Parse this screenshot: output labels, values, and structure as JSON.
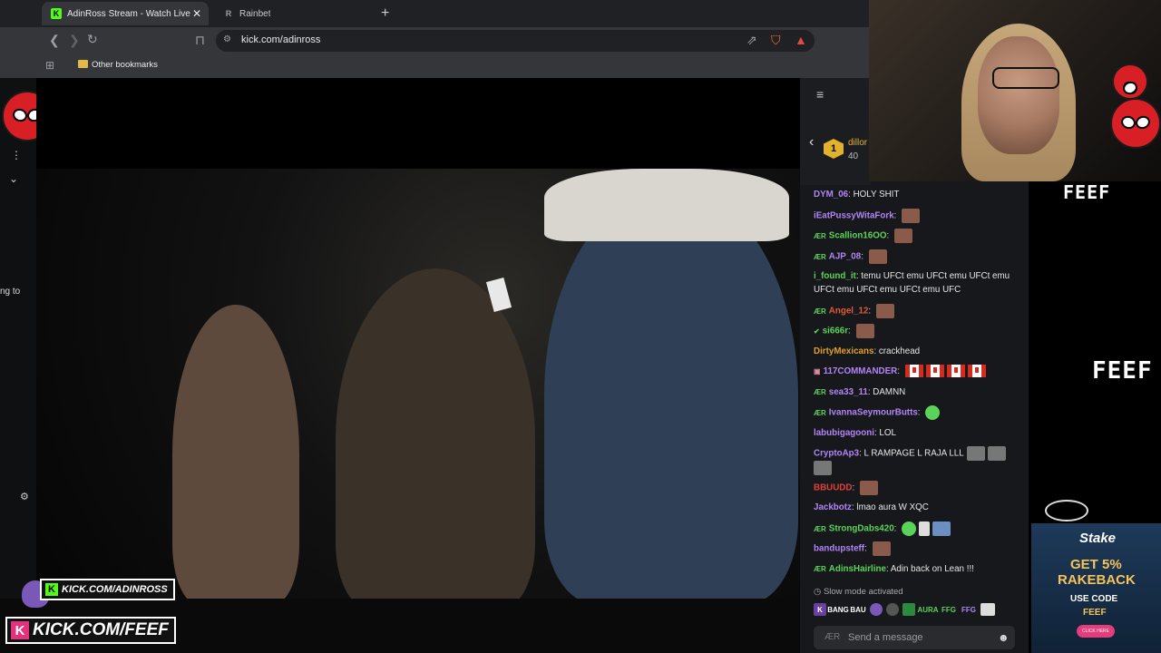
{
  "browser": {
    "tabs": [
      {
        "title": "AdinRoss Stream - Watch Live",
        "active": true
      },
      {
        "title": "Rainbet",
        "active": false
      }
    ],
    "new_tab_label": "+",
    "url": "kick.com/adinross",
    "bookmarks": [
      {
        "label": "Other bookmarks"
      }
    ]
  },
  "left_sidebar": {
    "partial_text": "ng to"
  },
  "chat": {
    "top_gifter": {
      "rank": "1",
      "name": "dillor",
      "count": "40"
    },
    "messages": [
      {
        "user": "DYM_06",
        "color": "#b185f5",
        "text": "HOLY SHIT"
      },
      {
        "user": "iEatPussyWitaFork",
        "color": "#b185f5",
        "text": ""
      },
      {
        "user": "Scallion16OO",
        "color": "#5bd35b",
        "text": ""
      },
      {
        "user": "AJP_08",
        "color": "#b185f5",
        "text": ""
      },
      {
        "user": "i_found_it",
        "color": "#5bd35b",
        "text": "temu UFCt emu UFCt emu UFCt emu UFCt emu UFCt emu UFCt emu UFC"
      },
      {
        "user": "Angel_12",
        "color": "#e05a3a",
        "text": ""
      },
      {
        "user": "si666r",
        "color": "#5bd35b",
        "text": ""
      },
      {
        "user": "DirtyMexicans",
        "color": "#e0a12b",
        "text": "crackhead"
      },
      {
        "user": "117COMMANDER",
        "color": "#b185f5",
        "text": ""
      },
      {
        "user": "sea33_11",
        "color": "#b185f5",
        "text": "DAMNN"
      },
      {
        "user": "IvannaSeymourButts",
        "color": "#b185f5",
        "text": ""
      },
      {
        "user": "labubigagooni",
        "color": "#b185f5",
        "text": "LOL"
      },
      {
        "user": "CryptoAp3",
        "color": "#b185f5",
        "text": "L RAMPAGE L RAJA LLL"
      },
      {
        "user": "BBUUDD",
        "color": "#e0413a",
        "text": ""
      },
      {
        "user": "Jackbotz",
        "color": "#b185f5",
        "text": "lmao aura W XQC"
      },
      {
        "user": "StrongDabs420",
        "color": "#5bd35b",
        "text": ""
      },
      {
        "user": "bandupsteff",
        "color": "#b185f5",
        "text": ""
      },
      {
        "user": "AdinsHairline",
        "color": "#5bd35b",
        "text": "Adin back on Lean !!!"
      }
    ],
    "slow_mode": "Slow mode activated",
    "input_placeholder": "Send a message"
  },
  "overlay": {
    "feef_labels": [
      "FEEF",
      "FEEF"
    ],
    "kick_small": "KICK.COM/ADINROSS",
    "kick_big": "KICK.COM/FEEF",
    "stake": {
      "brand": "Stake",
      "line1": "GET 5%",
      "line2": "RAKEBACK",
      "code_label": "USE CODE",
      "code": "FEEF",
      "button": "CLICK HERE"
    }
  },
  "colors": {
    "kick_green": "#53fc18",
    "chat_bg": "#17181b",
    "stake_gold": "#f5c35c"
  }
}
